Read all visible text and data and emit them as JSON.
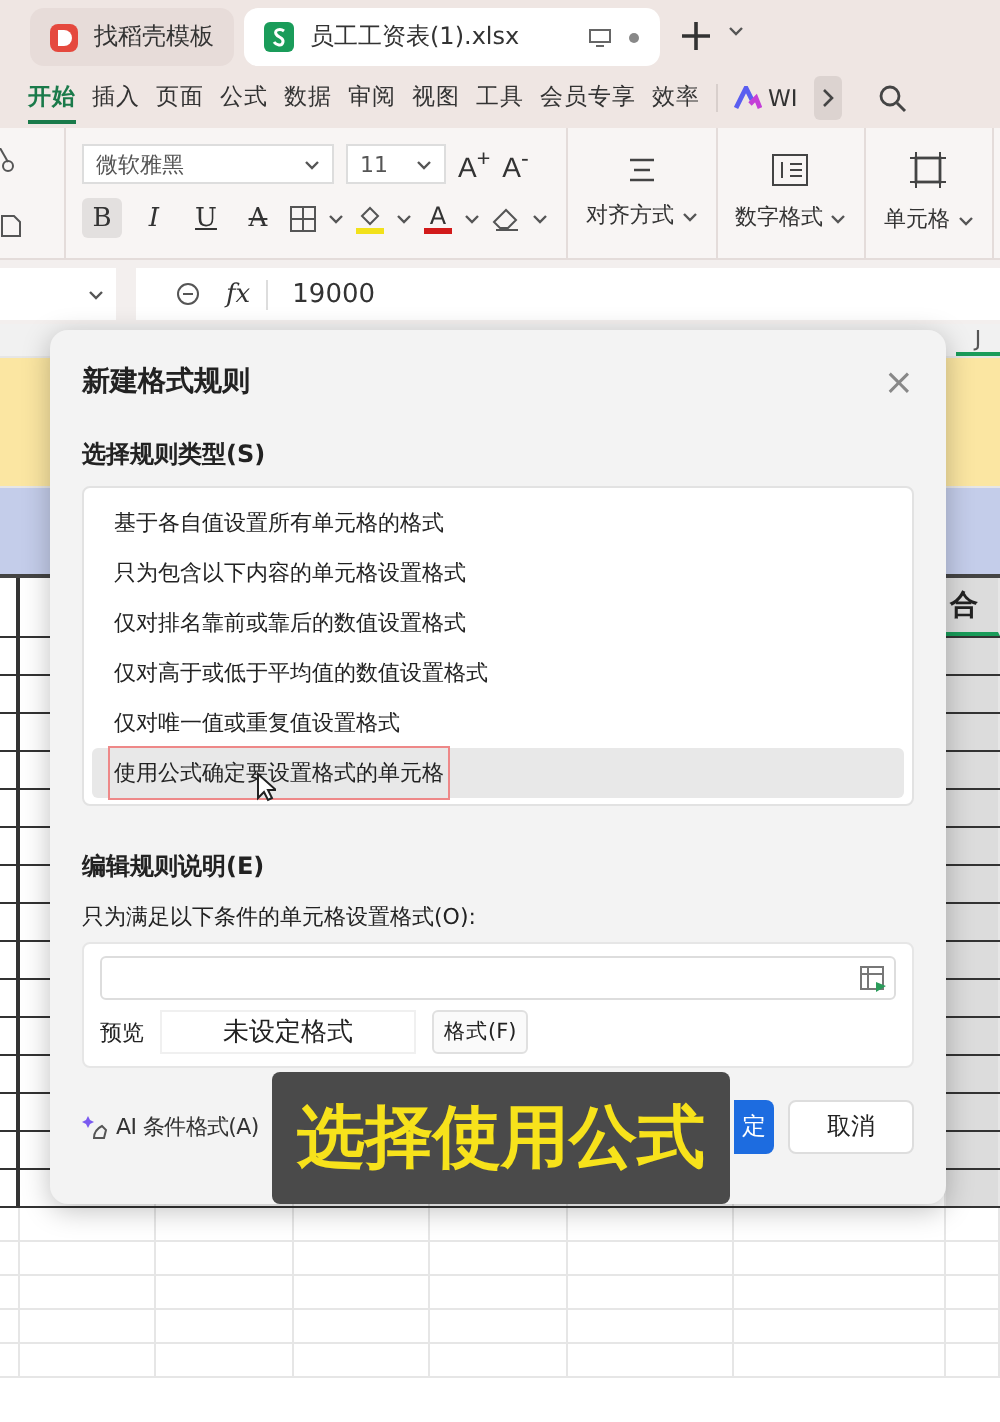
{
  "tabs": [
    {
      "label": "找稻壳模板",
      "selected": false,
      "kind": "docer"
    },
    {
      "label": "员工工资表(1).xlsx",
      "selected": true,
      "kind": "sheet"
    }
  ],
  "menu": [
    {
      "label": "开始",
      "selected": true
    },
    {
      "label": "插入",
      "selected": false
    },
    {
      "label": "页面",
      "selected": false
    },
    {
      "label": "公式",
      "selected": false
    },
    {
      "label": "数据",
      "selected": false
    },
    {
      "label": "审阅",
      "selected": false
    },
    {
      "label": "视图",
      "selected": false
    },
    {
      "label": "工具",
      "selected": false
    },
    {
      "label": "会员专享",
      "selected": false
    },
    {
      "label": "效率",
      "selected": false
    }
  ],
  "ai_menu": "WI",
  "ribbon": {
    "font": "微软雅黑",
    "size": "11",
    "grow": "A$^{+}$",
    "shrink": "A$^{-}$",
    "styles": [
      {
        "label": "B",
        "kind": "bold",
        "selected": true
      },
      {
        "label": "I",
        "kind": "italic",
        "selected": false
      },
      {
        "label": "U",
        "kind": "underline",
        "selected": false
      },
      {
        "label": "A",
        "kind": "strike",
        "selected": false
      }
    ],
    "font_color": "A",
    "groups": [
      {
        "label": "对齐方式",
        "kind": "align"
      },
      {
        "label": "数字格式",
        "kind": "number"
      },
      {
        "label": "单元格",
        "kind": "cell"
      }
    ]
  },
  "formula_bar": {
    "fx": "fx",
    "value": "19000"
  },
  "sheet": {
    "column_header": "J",
    "cell": "合"
  },
  "dialog": {
    "title": "新建格式规则",
    "close": "×",
    "rule_type_label": "选择规则类型(S)",
    "rule_types": [
      {
        "label": "基于各自值设置所有单元格的格式",
        "selected": false
      },
      {
        "label": "只为包含以下内容的单元格设置格式",
        "selected": false
      },
      {
        "label": "仅对排名靠前或靠后的数值设置格式",
        "selected": false
      },
      {
        "label": "仅对高于或低于平均值的数值设置格式",
        "selected": false
      },
      {
        "label": "仅对唯一值或重复值设置格式",
        "selected": false
      },
      {
        "label": "使用公式确定要设置格式的单元格",
        "selected": true
      }
    ],
    "edit_label": "编辑规则说明(E)",
    "condition_label": "只为满足以下条件的单元格设置格式(O):",
    "preview_label": "预览",
    "preview_text": "未设定格式",
    "format_button": "格式(F)",
    "ai_button": "AI 条件格式(A)",
    "ok_button": "定",
    "cancel_button": "取消"
  },
  "caption": "选择使用公式"
}
